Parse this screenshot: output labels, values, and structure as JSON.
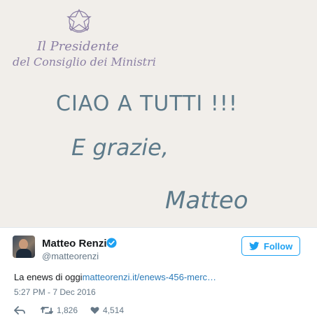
{
  "photo": {
    "letterhead_line1": "Il Presidente",
    "letterhead_line2": "del Consiglio dei Ministri",
    "note_line1": "CIAO A TUTTI !!!",
    "note_line2": "E grazie,",
    "signature": "Matteo"
  },
  "tweet": {
    "name": "Matteo Renzi",
    "handle": "@matteorenzi",
    "follow_label": "Follow",
    "text": "La enews di oggi",
    "link": "matteorenzi.it/enews-456-merc…",
    "timestamp": "5:27 PM - 7 Dec 2016",
    "retweets": "1,826",
    "likes": "4,514"
  },
  "colors": {
    "accent": "#1da1f2",
    "ink": "#5d7a8a",
    "paper": "#f1eeea"
  }
}
